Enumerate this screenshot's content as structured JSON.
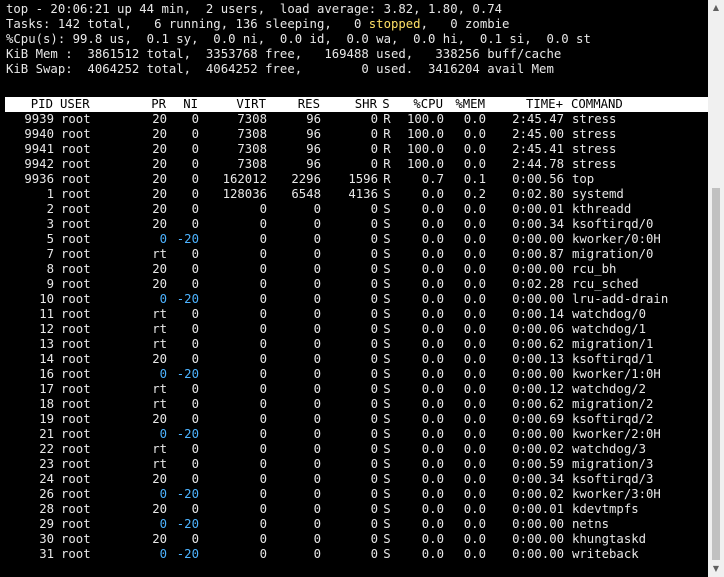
{
  "summary": {
    "line1": "top - 20:06:21 up 44 min,  2 users,  load average: 3.82, 1.80, 0.74",
    "line2_pre": "Tasks: 142 total,   6 running, 136 sleeping,   0 ",
    "line2_stopped": "stopped",
    "line2_post": ",   0 zombie",
    "line3": "%Cpu(s): 99.8 us,  0.1 sy,  0.0 ni,  0.0 id,  0.0 wa,  0.0 hi,  0.1 si,  0.0 st",
    "line4": "KiB Mem :  3861512 total,  3353768 free,   169488 used,   338256 buff/cache",
    "line5": "KiB Swap:  4064252 total,  4064252 free,        0 used.  3416204 avail Mem"
  },
  "columns": {
    "pid": "PID",
    "user": "USER",
    "pr": "PR",
    "ni": "NI",
    "virt": "VIRT",
    "res": "RES",
    "shr": "SHR",
    "s": "S",
    "cpu": "%CPU",
    "mem": "%MEM",
    "time": "TIME+",
    "cmd": "COMMAND"
  },
  "processes": [
    {
      "pid": "9939",
      "user": "root",
      "pr": "20",
      "ni": "0",
      "virt": "7308",
      "res": "96",
      "shr": "0",
      "s": "R",
      "cpu": "100.0",
      "mem": "0.0",
      "time": "2:45.47",
      "cmd": "stress"
    },
    {
      "pid": "9940",
      "user": "root",
      "pr": "20",
      "ni": "0",
      "virt": "7308",
      "res": "96",
      "shr": "0",
      "s": "R",
      "cpu": "100.0",
      "mem": "0.0",
      "time": "2:45.00",
      "cmd": "stress"
    },
    {
      "pid": "9941",
      "user": "root",
      "pr": "20",
      "ni": "0",
      "virt": "7308",
      "res": "96",
      "shr": "0",
      "s": "R",
      "cpu": "100.0",
      "mem": "0.0",
      "time": "2:45.41",
      "cmd": "stress"
    },
    {
      "pid": "9942",
      "user": "root",
      "pr": "20",
      "ni": "0",
      "virt": "7308",
      "res": "96",
      "shr": "0",
      "s": "R",
      "cpu": "100.0",
      "mem": "0.0",
      "time": "2:44.78",
      "cmd": "stress"
    },
    {
      "pid": "9936",
      "user": "root",
      "pr": "20",
      "ni": "0",
      "virt": "162012",
      "res": "2296",
      "shr": "1596",
      "s": "R",
      "cpu": "0.7",
      "mem": "0.1",
      "time": "0:00.56",
      "cmd": "top"
    },
    {
      "pid": "1",
      "user": "root",
      "pr": "20",
      "ni": "0",
      "virt": "128036",
      "res": "6548",
      "shr": "4136",
      "s": "S",
      "cpu": "0.0",
      "mem": "0.2",
      "time": "0:02.80",
      "cmd": "systemd"
    },
    {
      "pid": "2",
      "user": "root",
      "pr": "20",
      "ni": "0",
      "virt": "0",
      "res": "0",
      "shr": "0",
      "s": "S",
      "cpu": "0.0",
      "mem": "0.0",
      "time": "0:00.01",
      "cmd": "kthreadd"
    },
    {
      "pid": "3",
      "user": "root",
      "pr": "20",
      "ni": "0",
      "virt": "0",
      "res": "0",
      "shr": "0",
      "s": "S",
      "cpu": "0.0",
      "mem": "0.0",
      "time": "0:00.34",
      "cmd": "ksoftirqd/0"
    },
    {
      "pid": "5",
      "user": "root",
      "pr": "0",
      "ni": "-20",
      "virt": "0",
      "res": "0",
      "shr": "0",
      "s": "S",
      "cpu": "0.0",
      "mem": "0.0",
      "time": "0:00.00",
      "cmd": "kworker/0:0H"
    },
    {
      "pid": "7",
      "user": "root",
      "pr": "rt",
      "ni": "0",
      "virt": "0",
      "res": "0",
      "shr": "0",
      "s": "S",
      "cpu": "0.0",
      "mem": "0.0",
      "time": "0:00.87",
      "cmd": "migration/0"
    },
    {
      "pid": "8",
      "user": "root",
      "pr": "20",
      "ni": "0",
      "virt": "0",
      "res": "0",
      "shr": "0",
      "s": "S",
      "cpu": "0.0",
      "mem": "0.0",
      "time": "0:00.00",
      "cmd": "rcu_bh"
    },
    {
      "pid": "9",
      "user": "root",
      "pr": "20",
      "ni": "0",
      "virt": "0",
      "res": "0",
      "shr": "0",
      "s": "S",
      "cpu": "0.0",
      "mem": "0.0",
      "time": "0:02.28",
      "cmd": "rcu_sched"
    },
    {
      "pid": "10",
      "user": "root",
      "pr": "0",
      "ni": "-20",
      "virt": "0",
      "res": "0",
      "shr": "0",
      "s": "S",
      "cpu": "0.0",
      "mem": "0.0",
      "time": "0:00.00",
      "cmd": "lru-add-drain"
    },
    {
      "pid": "11",
      "user": "root",
      "pr": "rt",
      "ni": "0",
      "virt": "0",
      "res": "0",
      "shr": "0",
      "s": "S",
      "cpu": "0.0",
      "mem": "0.0",
      "time": "0:00.14",
      "cmd": "watchdog/0"
    },
    {
      "pid": "12",
      "user": "root",
      "pr": "rt",
      "ni": "0",
      "virt": "0",
      "res": "0",
      "shr": "0",
      "s": "S",
      "cpu": "0.0",
      "mem": "0.0",
      "time": "0:00.06",
      "cmd": "watchdog/1"
    },
    {
      "pid": "13",
      "user": "root",
      "pr": "rt",
      "ni": "0",
      "virt": "0",
      "res": "0",
      "shr": "0",
      "s": "S",
      "cpu": "0.0",
      "mem": "0.0",
      "time": "0:00.62",
      "cmd": "migration/1"
    },
    {
      "pid": "14",
      "user": "root",
      "pr": "20",
      "ni": "0",
      "virt": "0",
      "res": "0",
      "shr": "0",
      "s": "S",
      "cpu": "0.0",
      "mem": "0.0",
      "time": "0:00.13",
      "cmd": "ksoftirqd/1"
    },
    {
      "pid": "16",
      "user": "root",
      "pr": "0",
      "ni": "-20",
      "virt": "0",
      "res": "0",
      "shr": "0",
      "s": "S",
      "cpu": "0.0",
      "mem": "0.0",
      "time": "0:00.00",
      "cmd": "kworker/1:0H"
    },
    {
      "pid": "17",
      "user": "root",
      "pr": "rt",
      "ni": "0",
      "virt": "0",
      "res": "0",
      "shr": "0",
      "s": "S",
      "cpu": "0.0",
      "mem": "0.0",
      "time": "0:00.12",
      "cmd": "watchdog/2"
    },
    {
      "pid": "18",
      "user": "root",
      "pr": "rt",
      "ni": "0",
      "virt": "0",
      "res": "0",
      "shr": "0",
      "s": "S",
      "cpu": "0.0",
      "mem": "0.0",
      "time": "0:00.62",
      "cmd": "migration/2"
    },
    {
      "pid": "19",
      "user": "root",
      "pr": "20",
      "ni": "0",
      "virt": "0",
      "res": "0",
      "shr": "0",
      "s": "S",
      "cpu": "0.0",
      "mem": "0.0",
      "time": "0:00.69",
      "cmd": "ksoftirqd/2"
    },
    {
      "pid": "21",
      "user": "root",
      "pr": "0",
      "ni": "-20",
      "virt": "0",
      "res": "0",
      "shr": "0",
      "s": "S",
      "cpu": "0.0",
      "mem": "0.0",
      "time": "0:00.00",
      "cmd": "kworker/2:0H"
    },
    {
      "pid": "22",
      "user": "root",
      "pr": "rt",
      "ni": "0",
      "virt": "0",
      "res": "0",
      "shr": "0",
      "s": "S",
      "cpu": "0.0",
      "mem": "0.0",
      "time": "0:00.02",
      "cmd": "watchdog/3"
    },
    {
      "pid": "23",
      "user": "root",
      "pr": "rt",
      "ni": "0",
      "virt": "0",
      "res": "0",
      "shr": "0",
      "s": "S",
      "cpu": "0.0",
      "mem": "0.0",
      "time": "0:00.59",
      "cmd": "migration/3"
    },
    {
      "pid": "24",
      "user": "root",
      "pr": "20",
      "ni": "0",
      "virt": "0",
      "res": "0",
      "shr": "0",
      "s": "S",
      "cpu": "0.0",
      "mem": "0.0",
      "time": "0:00.34",
      "cmd": "ksoftirqd/3"
    },
    {
      "pid": "26",
      "user": "root",
      "pr": "0",
      "ni": "-20",
      "virt": "0",
      "res": "0",
      "shr": "0",
      "s": "S",
      "cpu": "0.0",
      "mem": "0.0",
      "time": "0:00.02",
      "cmd": "kworker/3:0H"
    },
    {
      "pid": "28",
      "user": "root",
      "pr": "20",
      "ni": "0",
      "virt": "0",
      "res": "0",
      "shr": "0",
      "s": "S",
      "cpu": "0.0",
      "mem": "0.0",
      "time": "0:00.01",
      "cmd": "kdevtmpfs"
    },
    {
      "pid": "29",
      "user": "root",
      "pr": "0",
      "ni": "-20",
      "virt": "0",
      "res": "0",
      "shr": "0",
      "s": "S",
      "cpu": "0.0",
      "mem": "0.0",
      "time": "0:00.00",
      "cmd": "netns"
    },
    {
      "pid": "30",
      "user": "root",
      "pr": "20",
      "ni": "0",
      "virt": "0",
      "res": "0",
      "shr": "0",
      "s": "S",
      "cpu": "0.0",
      "mem": "0.0",
      "time": "0:00.00",
      "cmd": "khungtaskd"
    },
    {
      "pid": "31",
      "user": "root",
      "pr": "0",
      "ni": "-20",
      "virt": "0",
      "res": "0",
      "shr": "0",
      "s": "S",
      "cpu": "0.0",
      "mem": "0.0",
      "time": "0:00.00",
      "cmd": "writeback"
    }
  ],
  "colors": {
    "background": "#000000",
    "text": "#e8e8e8",
    "header_bg": "#ffffff",
    "stopped": "#ffe066",
    "negative_nice": "#4db3ff"
  },
  "icons": {
    "scroll_up": "▲",
    "scroll_down": "▼"
  }
}
